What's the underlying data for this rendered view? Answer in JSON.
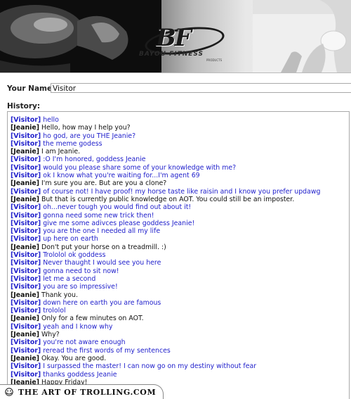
{
  "banner": {
    "logo_mark": "BF",
    "logo_text": "BAYOU FITNESS",
    "logo_sub": "PRODUCTS"
  },
  "form": {
    "name_label": "Your Name:",
    "name_value": "Visitor",
    "history_label": "History:"
  },
  "chat": [
    {
      "who": "[Visitor]",
      "role": "visitor",
      "text": "hello"
    },
    {
      "who": "[Jeanie]",
      "role": "jeanie",
      "text": "Hello, how may I help you?"
    },
    {
      "who": "[Visitor]",
      "role": "visitor",
      "text": "ho god, are you THE Jeanie?"
    },
    {
      "who": "[Visitor]",
      "role": "visitor",
      "text": "the meme godess"
    },
    {
      "who": "[Jeanie]",
      "role": "jeanie",
      "text": "I am Jeanie."
    },
    {
      "who": "[Visitor]",
      "role": "visitor",
      "text": ":O I'm honored, goddess Jeanie"
    },
    {
      "who": "[Visitor]",
      "role": "visitor",
      "text": "would you please share some of your knowledge with me?"
    },
    {
      "who": "[Visitor]",
      "role": "visitor",
      "text": "ok I know what you're waiting for...I'm agent 69"
    },
    {
      "who": "[Jeanie]",
      "role": "jeanie",
      "text": "I'm sure you are.  But are you a clone?"
    },
    {
      "who": "[Visitor]",
      "role": "visitor",
      "text": "of course not! I have proof! my horse taste like raisin and I know you prefer updawg"
    },
    {
      "who": "[Jeanie]",
      "role": "jeanie",
      "text": "But that is currently public knowledge on AOT.  You could still be an imposter."
    },
    {
      "who": "[Visitor]",
      "role": "visitor",
      "text": "oh...never tough you would find out about it!"
    },
    {
      "who": "[Visitor]",
      "role": "visitor",
      "text": "gonna need some new trick then!"
    },
    {
      "who": "[Visitor]",
      "role": "visitor",
      "text": "give me some adivces please goddess Jeanie!"
    },
    {
      "who": "[Visitor]",
      "role": "visitor",
      "text": "you are the one I needed all my life"
    },
    {
      "who": "[Visitor]",
      "role": "visitor",
      "text": "up here on earth"
    },
    {
      "who": "[Jeanie]",
      "role": "jeanie",
      "text": "Don't put your horse on a treadmill.  :)"
    },
    {
      "who": "[Visitor]",
      "role": "visitor",
      "text": "Trololol ok goddess"
    },
    {
      "who": "[Visitor]",
      "role": "visitor",
      "text": "Never thaught I would see you here"
    },
    {
      "who": "[Visitor]",
      "role": "visitor",
      "text": "gonna need to sit now!"
    },
    {
      "who": "[Visitor]",
      "role": "visitor",
      "text": "let me a second"
    },
    {
      "who": "[Visitor]",
      "role": "visitor",
      "text": "you are so impressive!"
    },
    {
      "who": "[Jeanie]",
      "role": "jeanie",
      "text": "Thank you."
    },
    {
      "who": "[Visitor]",
      "role": "visitor",
      "text": "down here on earth you are famous"
    },
    {
      "who": "[Visitor]",
      "role": "visitor",
      "text": "trololol"
    },
    {
      "who": "[Jeanie]",
      "role": "jeanie",
      "text": "Only for a few minutes on AOT."
    },
    {
      "who": "[Visitor]",
      "role": "visitor",
      "text": "yeah and I know why"
    },
    {
      "who": "[Jeanie]",
      "role": "jeanie",
      "text": "Why?"
    },
    {
      "who": "[Visitor]",
      "role": "visitor",
      "text": "you're not aware enough"
    },
    {
      "who": "[Visitor]",
      "role": "visitor",
      "text": "reread the first words of my sentences"
    },
    {
      "who": "[Jeanie]",
      "role": "jeanie",
      "text": "Okay.  You are good."
    },
    {
      "who": "[Visitor]",
      "role": "visitor",
      "text": "I surpassed the master! I can now go on my destiny without fear"
    },
    {
      "who": "[Visitor]",
      "role": "visitor",
      "text": "thanks goddess Jeanie"
    },
    {
      "who": "[Jeanie]",
      "role": "jeanie",
      "text": "Happy Friday!"
    }
  ],
  "watermark": {
    "text": "THE ART OF TROLLING.COM"
  }
}
